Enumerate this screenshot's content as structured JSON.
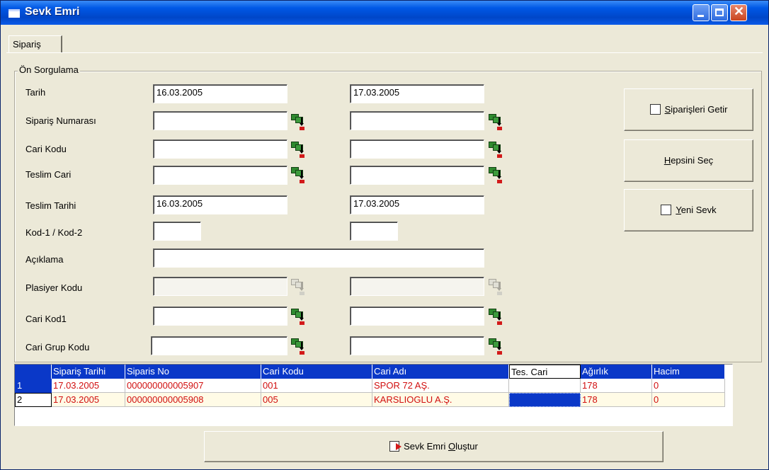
{
  "window": {
    "title": "Sevk Emri"
  },
  "tabs": [
    {
      "label": "Sipariş"
    }
  ],
  "group": {
    "label": "Ön Sorgulama"
  },
  "fields": {
    "tarih": {
      "label": "Tarih",
      "from": "16.03.2005",
      "to": "17.03.2005"
    },
    "siparis_no": {
      "label": "Sipariş Numarası",
      "from": "",
      "to": ""
    },
    "cari_kodu": {
      "label": "Cari Kodu",
      "from": "",
      "to": ""
    },
    "teslim_cari": {
      "label": "Teslim Cari",
      "from": "",
      "to": ""
    },
    "teslim_tarihi": {
      "label": "Teslim Tarihi",
      "from": "16.03.2005",
      "to": "17.03.2005"
    },
    "kod": {
      "label": "Kod-1 / Kod-2",
      "from": "",
      "to": ""
    },
    "aciklama": {
      "label": "Açıklama",
      "value": ""
    },
    "plasiyer": {
      "label": "Plasiyer Kodu",
      "from": "",
      "to": ""
    },
    "cari_kod1": {
      "label": "Cari Kod1",
      "from": "",
      "to": ""
    },
    "cari_grup": {
      "label": "Cari Grup Kodu",
      "from": "",
      "to": ""
    }
  },
  "buttons": {
    "siparisleri_getir": {
      "accel": "S",
      "rest": "iparişleri Getir"
    },
    "hepsini_sec": {
      "accel": "H",
      "rest": "epsini Seç"
    },
    "yeni_sevk": {
      "accel": "Y",
      "rest": "eni Sevk"
    },
    "sevk_emri_olustur": {
      "pre": "Sevk Emri ",
      "accel": "O",
      "rest": "luştur"
    }
  },
  "grid": {
    "columns": [
      "Sipariş Tarihi",
      "Siparis No",
      "Cari Kodu",
      "Cari Adı",
      "Tes. Cari",
      "Ağırlık",
      "Hacim"
    ],
    "rows": [
      {
        "num": "1",
        "cells": [
          "17.03.2005",
          "000000000005907",
          "001",
          "SPOR 72 AŞ.",
          "",
          "178",
          "0"
        ]
      },
      {
        "num": "2",
        "cells": [
          "17.03.2005",
          "000000000005908",
          "005",
          "KARSLIOGLU A.Ş.",
          "",
          "178",
          "0"
        ]
      }
    ]
  },
  "colors": {
    "title_bar": "#0058e6",
    "grid_header": "#0a38c8",
    "row_text": "#d10f0f",
    "row_alt": "#fffbe6"
  }
}
